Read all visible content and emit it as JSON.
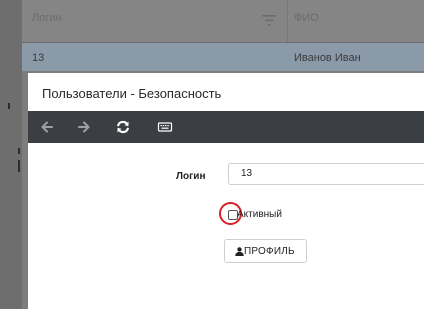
{
  "grid": {
    "columns": [
      "Логин",
      "ФИО"
    ],
    "rows": [
      {
        "login": "13",
        "fio": "Иванов Иван"
      }
    ]
  },
  "modal": {
    "title": "Пользователи - Безопасность",
    "toolbar": {
      "icons": [
        "arrow-left-icon",
        "arrow-right-icon",
        "refresh-icon",
        "keyboard-icon"
      ]
    },
    "form": {
      "login_label": "Логин",
      "login_value": "13",
      "active_label": "Активный",
      "active_checked": false,
      "profile_button": "ПРОФИЛЬ"
    },
    "highlight_color": "#d8202a"
  }
}
